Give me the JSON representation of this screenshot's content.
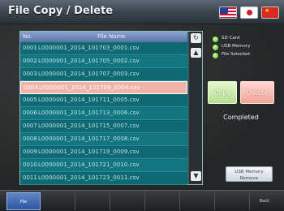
{
  "header": {
    "title": "File Copy / Delete",
    "flags": [
      "us-flag-icon",
      "japan-flag-icon",
      "china-flag-icon"
    ]
  },
  "file_list": {
    "columns": {
      "no": "No.",
      "name": "File Name"
    },
    "selected_index": 3,
    "rows": [
      {
        "no": "0001",
        "name": "L0000001_2014_101703_0001.csv"
      },
      {
        "no": "0002",
        "name": "L0000001_2014_101705_0002.csv"
      },
      {
        "no": "0003",
        "name": "L0000001_2014_101707_0003.csv"
      },
      {
        "no": "0004",
        "name": "L0000001_2014_101709_0004.csv"
      },
      {
        "no": "0005",
        "name": "L0000001_2014_101711_0005.csv"
      },
      {
        "no": "0006",
        "name": "L0000001_2014_101713_0006.csv"
      },
      {
        "no": "0007",
        "name": "L0000001_2014_101715_0007.csv"
      },
      {
        "no": "0008",
        "name": "L0000001_2014_101717_0008.csv"
      },
      {
        "no": "0009",
        "name": "L0000001_2014_101719_0009.csv"
      },
      {
        "no": "0010",
        "name": "L0000001_2014_101721_0010.csv"
      },
      {
        "no": "0011",
        "name": "L0000001_2014_101723_0011.csv"
      }
    ]
  },
  "status_indicators": {
    "items": [
      "SD Card",
      "USB Memory",
      "File Selected"
    ],
    "color": "#55c22a"
  },
  "actions": {
    "copy": "Copy",
    "delete": "Delete",
    "status_text": "Completed",
    "usb_remove_line1": "USB Memory",
    "usb_remove_line2": "Remove"
  },
  "function_keys": {
    "f1": "File",
    "last": "Back"
  },
  "colors": {
    "list_bg": "#0e6973",
    "selected_row": "#f2b3a8",
    "copy_button": "#b7df8f",
    "delete_button": "#f4a497"
  }
}
